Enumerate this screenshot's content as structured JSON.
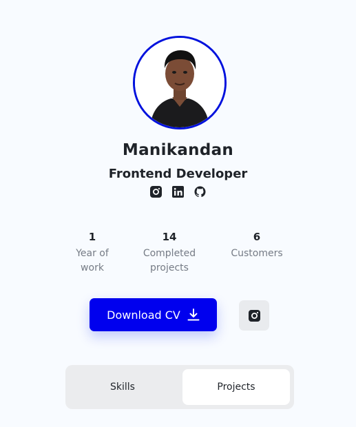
{
  "profile": {
    "avatar_alt": "profile-photo",
    "name": "Manikandan",
    "role": "Frontend Developer",
    "accent_color": "#0011dd"
  },
  "socials": [
    {
      "icon": "instagram-icon"
    },
    {
      "icon": "linkedin-icon"
    },
    {
      "icon": "github-icon"
    }
  ],
  "stats": [
    {
      "value": "1",
      "label": "Year of work"
    },
    {
      "value": "14",
      "label": "Completed projects"
    },
    {
      "value": "6",
      "label": "Customers"
    }
  ],
  "actions": {
    "download_label": "Download CV",
    "download_icon": "download-icon",
    "secondary_icon": "instagram-icon",
    "primary_color": "#0000ee"
  },
  "tabs": [
    {
      "label": "Skills",
      "active": false
    },
    {
      "label": "Projects",
      "active": true
    }
  ]
}
